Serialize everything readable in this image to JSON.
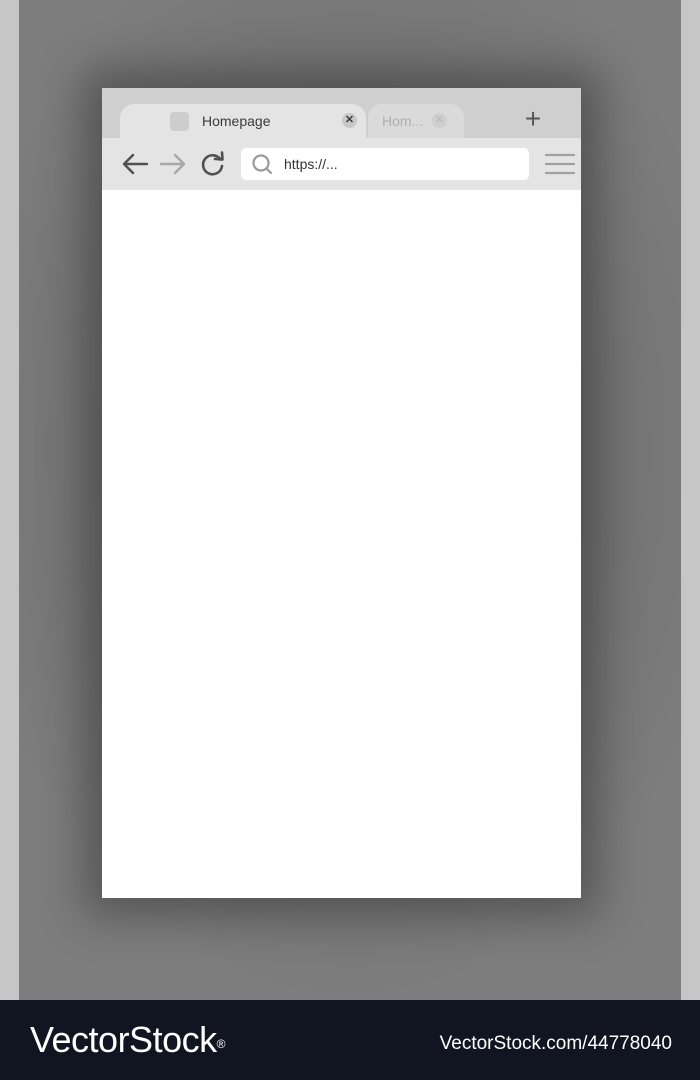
{
  "browser": {
    "tabs": [
      {
        "title": "Homepage",
        "state": "active"
      },
      {
        "title": "Hom...",
        "state": "inactive"
      }
    ],
    "address": {
      "url": "https://..."
    }
  },
  "icons": {
    "back": "arrow-left-icon",
    "forward": "arrow-right-icon",
    "reload": "reload-icon",
    "search": "search-icon",
    "menu": "hamburger-menu-icon",
    "new_tab": "plus-icon",
    "close": "close-icon"
  },
  "footer": {
    "brand": "VectorStock",
    "registered": "®",
    "image_id": "VectorStock.com/44778040"
  },
  "colors": {
    "backdrop": "#6e6e6e",
    "tabbar": "#cfcfcf",
    "toolbar": "#e4e4e4",
    "page": "#ffffff",
    "footer": "#111522"
  }
}
